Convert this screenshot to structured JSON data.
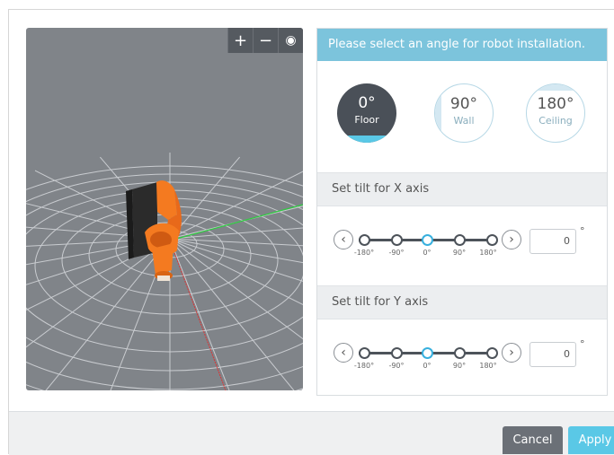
{
  "viewport": {
    "toolbar": {
      "zoom_in": "+",
      "zoom_out": "−",
      "view": "◉"
    }
  },
  "panel": {
    "title": "Please select an angle for robot installation.",
    "angles": [
      {
        "deg": "0°",
        "label": "Floor",
        "selected": true
      },
      {
        "deg": "90°",
        "label": "Wall",
        "selected": false
      },
      {
        "deg": "180°",
        "label": "Ceiling",
        "selected": false
      }
    ],
    "tilt_x": {
      "title": "Set tilt for X axis",
      "ticks": [
        "-180°",
        "-90°",
        "0°",
        "90°",
        "180°"
      ],
      "value": "0",
      "unit": "°",
      "selected_tick": "0°"
    },
    "tilt_y": {
      "title": "Set tilt for Y axis",
      "ticks": [
        "-180°",
        "-90°",
        "0°",
        "90°",
        "180°"
      ],
      "value": "0",
      "unit": "°",
      "selected_tick": "0°"
    },
    "arrows": {
      "left": "‹",
      "right": "›"
    }
  },
  "footer": {
    "cancel": "Cancel",
    "apply": "Apply"
  },
  "colors": {
    "accent": "#5ac8e6",
    "header": "#7cc4dc",
    "robot_orange": "#f47a20",
    "robot_black": "#2b2b2b"
  }
}
